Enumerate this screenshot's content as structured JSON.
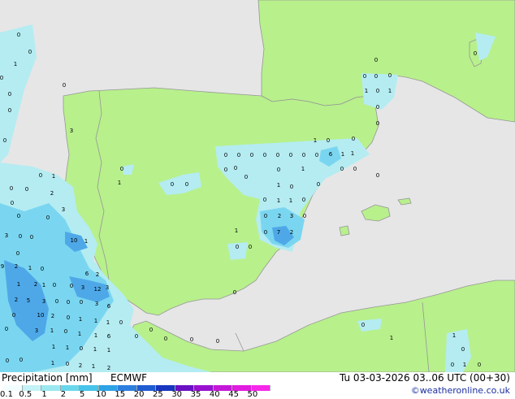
{
  "header": {
    "parameter": "Precipitation [mm]",
    "model": "ECMWF",
    "valid_time": "Tu 03-03-2026 03..06 UTC (00+30)",
    "credit": "©weatheronline.co.uk"
  },
  "legend": {
    "labels": [
      "0.1",
      "0.5",
      "1",
      "2",
      "5",
      "10",
      "15",
      "20",
      "25",
      "30",
      "35",
      "40",
      "45",
      "50"
    ],
    "colors": [
      "#f3fefe",
      "#c4f2f6",
      "#9be8f0",
      "#6ad8ec",
      "#48c3ea",
      "#2ea2e6",
      "#2d7fde",
      "#1f5cd2",
      "#1836c0",
      "#6a10c4",
      "#9a10d0",
      "#c418d8",
      "#e21ce0",
      "#f628ea"
    ]
  },
  "colors": {
    "sea": "#e6e6e6",
    "land": "#b8f08c",
    "border": "#969696",
    "light_precip": "#b4ecf2",
    "medium_precip": "#7ad6f0",
    "heavy_precip": "#4ea8e8"
  },
  "station_values": [
    "0",
    "1",
    "2",
    "3",
    "6",
    "7",
    "10",
    "12"
  ]
}
